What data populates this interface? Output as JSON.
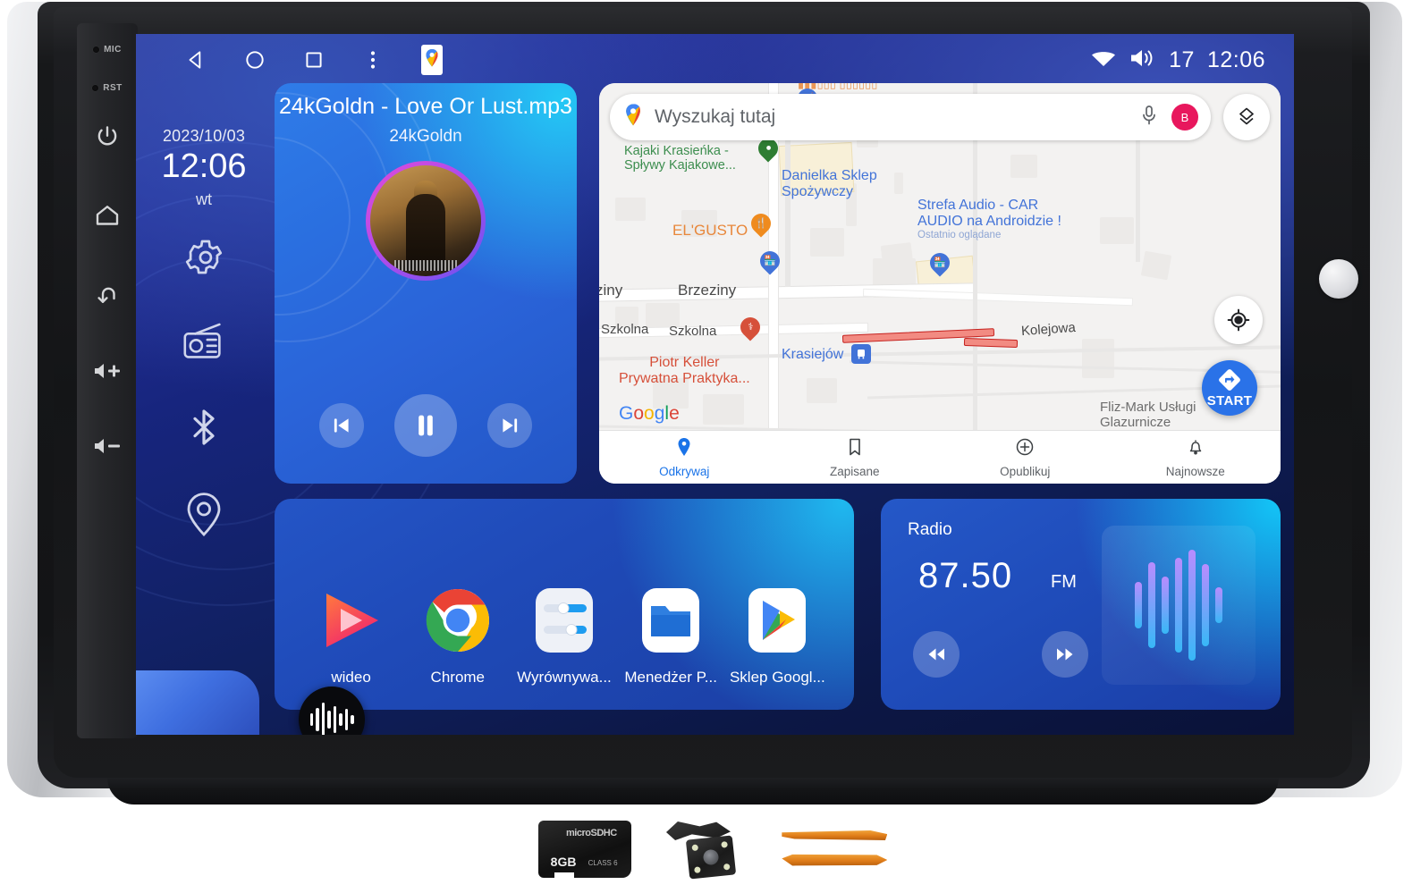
{
  "device": {
    "hardkeys": [
      {
        "name": "mic-pin",
        "label": "MIC"
      },
      {
        "name": "reset-pin",
        "label": "RST"
      },
      {
        "name": "power-button",
        "label": "power-icon"
      },
      {
        "name": "home-button",
        "label": "home-icon"
      },
      {
        "name": "back-button",
        "label": "back-icon"
      },
      {
        "name": "volume-up-button",
        "label": "volume-up-icon"
      },
      {
        "name": "volume-down-button",
        "label": "volume-down-icon"
      }
    ]
  },
  "statusbar": {
    "nav": [
      {
        "name": "android-back-icon"
      },
      {
        "name": "android-home-icon"
      },
      {
        "name": "android-recents-icon"
      },
      {
        "name": "android-more-icon"
      },
      {
        "name": "maps-shortcut-icon"
      }
    ],
    "wifi_icon": "wifi-icon",
    "volume_icon": "volume-icon",
    "volume_value": "17",
    "clock": "12:06"
  },
  "leftcol": {
    "date": "2023/10/03",
    "time": "12:06",
    "weekday": "wt",
    "icons": [
      {
        "name": "settings-icon"
      },
      {
        "name": "radio-icon"
      },
      {
        "name": "bluetooth-icon"
      },
      {
        "name": "location-icon"
      }
    ],
    "assistant_icon": "voice-assistant-icon"
  },
  "music": {
    "title": "24kGoldn - Love Or Lust.mp3",
    "artist": "24kGoldn",
    "album_art": "album-art",
    "controls": [
      {
        "name": "previous-track-button",
        "icon": "skip-previous-icon"
      },
      {
        "name": "play-pause-button",
        "icon": "pause-icon"
      },
      {
        "name": "next-track-button",
        "icon": "skip-next-icon"
      }
    ]
  },
  "map": {
    "search_placeholder": "Wyszukaj tutaj",
    "search_value": "",
    "mic_icon": "microphone-icon",
    "avatar_initial": "B",
    "layers_icon": "map-layers-icon",
    "locate_icon": "my-location-icon",
    "start_label": "START",
    "start_icon": "navigation-arrow-icon",
    "watermark": [
      "G",
      "o",
      "o",
      "g",
      "l",
      "e"
    ],
    "labels": [
      {
        "name": "poi-kajaki",
        "line1": "Kajaki Krasieńka -",
        "line2": "Spływy Kajakowe..."
      },
      {
        "name": "poi-danielka",
        "line1": "Danielka Sklep",
        "line2": "Spożywczy"
      },
      {
        "name": "poi-strefa-audio",
        "line1": "Strefa Audio - CAR",
        "line2": "AUDIO na Androidzie !",
        "sub": "Ostatnio oglądane"
      },
      {
        "name": "poi-elgusto",
        "line1": "EL'GUSTO"
      },
      {
        "name": "street-brzeziny",
        "line1": "Brzeziny"
      },
      {
        "name": "street-brzeziny-left",
        "line1": "ziny"
      },
      {
        "name": "street-szkolna-1",
        "line1": "Szkolna"
      },
      {
        "name": "street-szkolna-2",
        "line1": "Szkolna"
      },
      {
        "name": "street-kolejowa",
        "line1": "Kolejowa"
      },
      {
        "name": "poi-piotr-keller",
        "line1": "Piotr Keller",
        "line2": "Prywatna Praktyka..."
      },
      {
        "name": "station-krasiejow",
        "line1": "Krasiejów"
      },
      {
        "name": "poi-fliz-mark",
        "line1": "Fliz-Mark Usługi",
        "line2": "Glazurnicze"
      }
    ],
    "bottom_nav": [
      {
        "name": "map-tab-odkrywaj",
        "label": "Odkrywaj",
        "icon": "place-pin-icon",
        "active": true
      },
      {
        "name": "map-tab-zapisane",
        "label": "Zapisane",
        "icon": "bookmark-icon",
        "active": false
      },
      {
        "name": "map-tab-opublikuj",
        "label": "Opublikuj",
        "icon": "plus-circle-icon",
        "active": false
      },
      {
        "name": "map-tab-najnowsze",
        "label": "Najnowsze",
        "icon": "bell-icon",
        "active": false
      }
    ]
  },
  "apps": [
    {
      "name": "app-wideo",
      "label": "wideo",
      "icon": "video-player-icon"
    },
    {
      "name": "app-chrome",
      "label": "Chrome",
      "icon": "chrome-icon"
    },
    {
      "name": "app-wyrownywanie",
      "label": "Wyrównywa...",
      "icon": "equalizer-icon"
    },
    {
      "name": "app-menedzer-plikow",
      "label": "Menedżer P...",
      "icon": "file-manager-icon"
    },
    {
      "name": "app-sklep-google",
      "label": "Sklep Googl...",
      "icon": "play-store-icon"
    }
  ],
  "radio": {
    "title": "Radio",
    "frequency": "87.50",
    "band": "FM",
    "controls": [
      {
        "name": "radio-seek-down-button",
        "icon": "rewind-icon"
      },
      {
        "name": "radio-seek-up-button",
        "icon": "fast-forward-icon"
      }
    ],
    "visualizer": "audio-waveform-icon"
  },
  "accessories": [
    {
      "name": "microsd-card",
      "logo": "microSDHC",
      "capacity": "8GB",
      "class": "CLASS 6"
    },
    {
      "name": "reversing-camera",
      "label": "reversing-camera-icon"
    },
    {
      "name": "pry-tools",
      "label": "pry-tool-icon"
    }
  ],
  "colors": {
    "screen_blue": "#1b3fa4",
    "accent_cyan": "#13c4f6",
    "maps_blue": "#1a73e8",
    "start_blue": "#2a72e8",
    "avatar_pink": "#e8175d"
  }
}
